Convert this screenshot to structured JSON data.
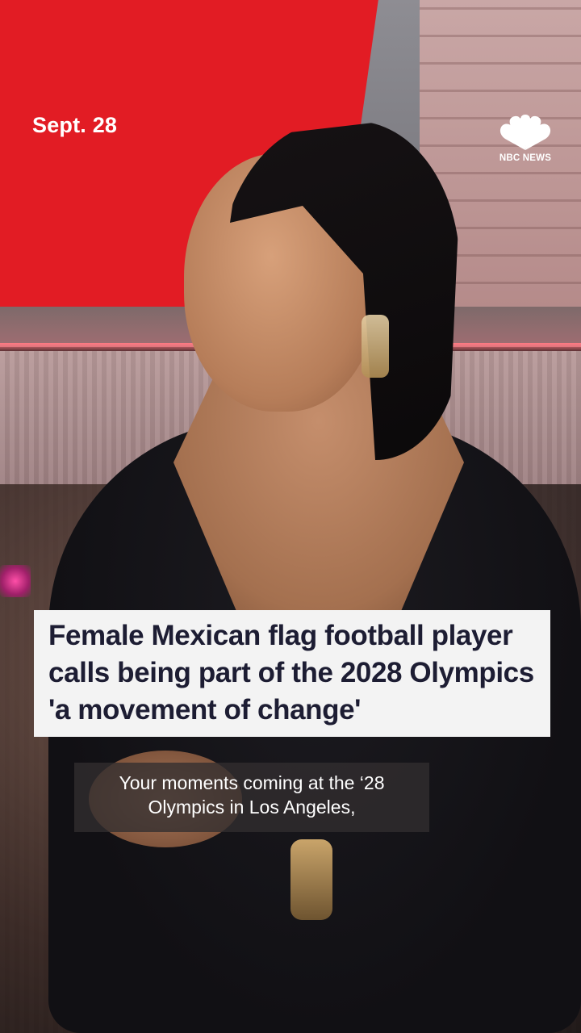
{
  "overlay": {
    "date": "Sept. 28",
    "logo_text": "NBC NEWS",
    "logo_icon": "peacock-icon",
    "headline": "Female Mexican flag football player calls being part of the 2028 Olympics 'a movement of change'",
    "caption": "Your moments coming at the ‘28 Olympics in Los Angeles,"
  },
  "colors": {
    "backdrop_red": "#e21c24",
    "headline_bg": "#f3f3f3",
    "headline_text": "#1d1d33",
    "caption_bg": "#322e30",
    "logo": "#ffffff"
  }
}
